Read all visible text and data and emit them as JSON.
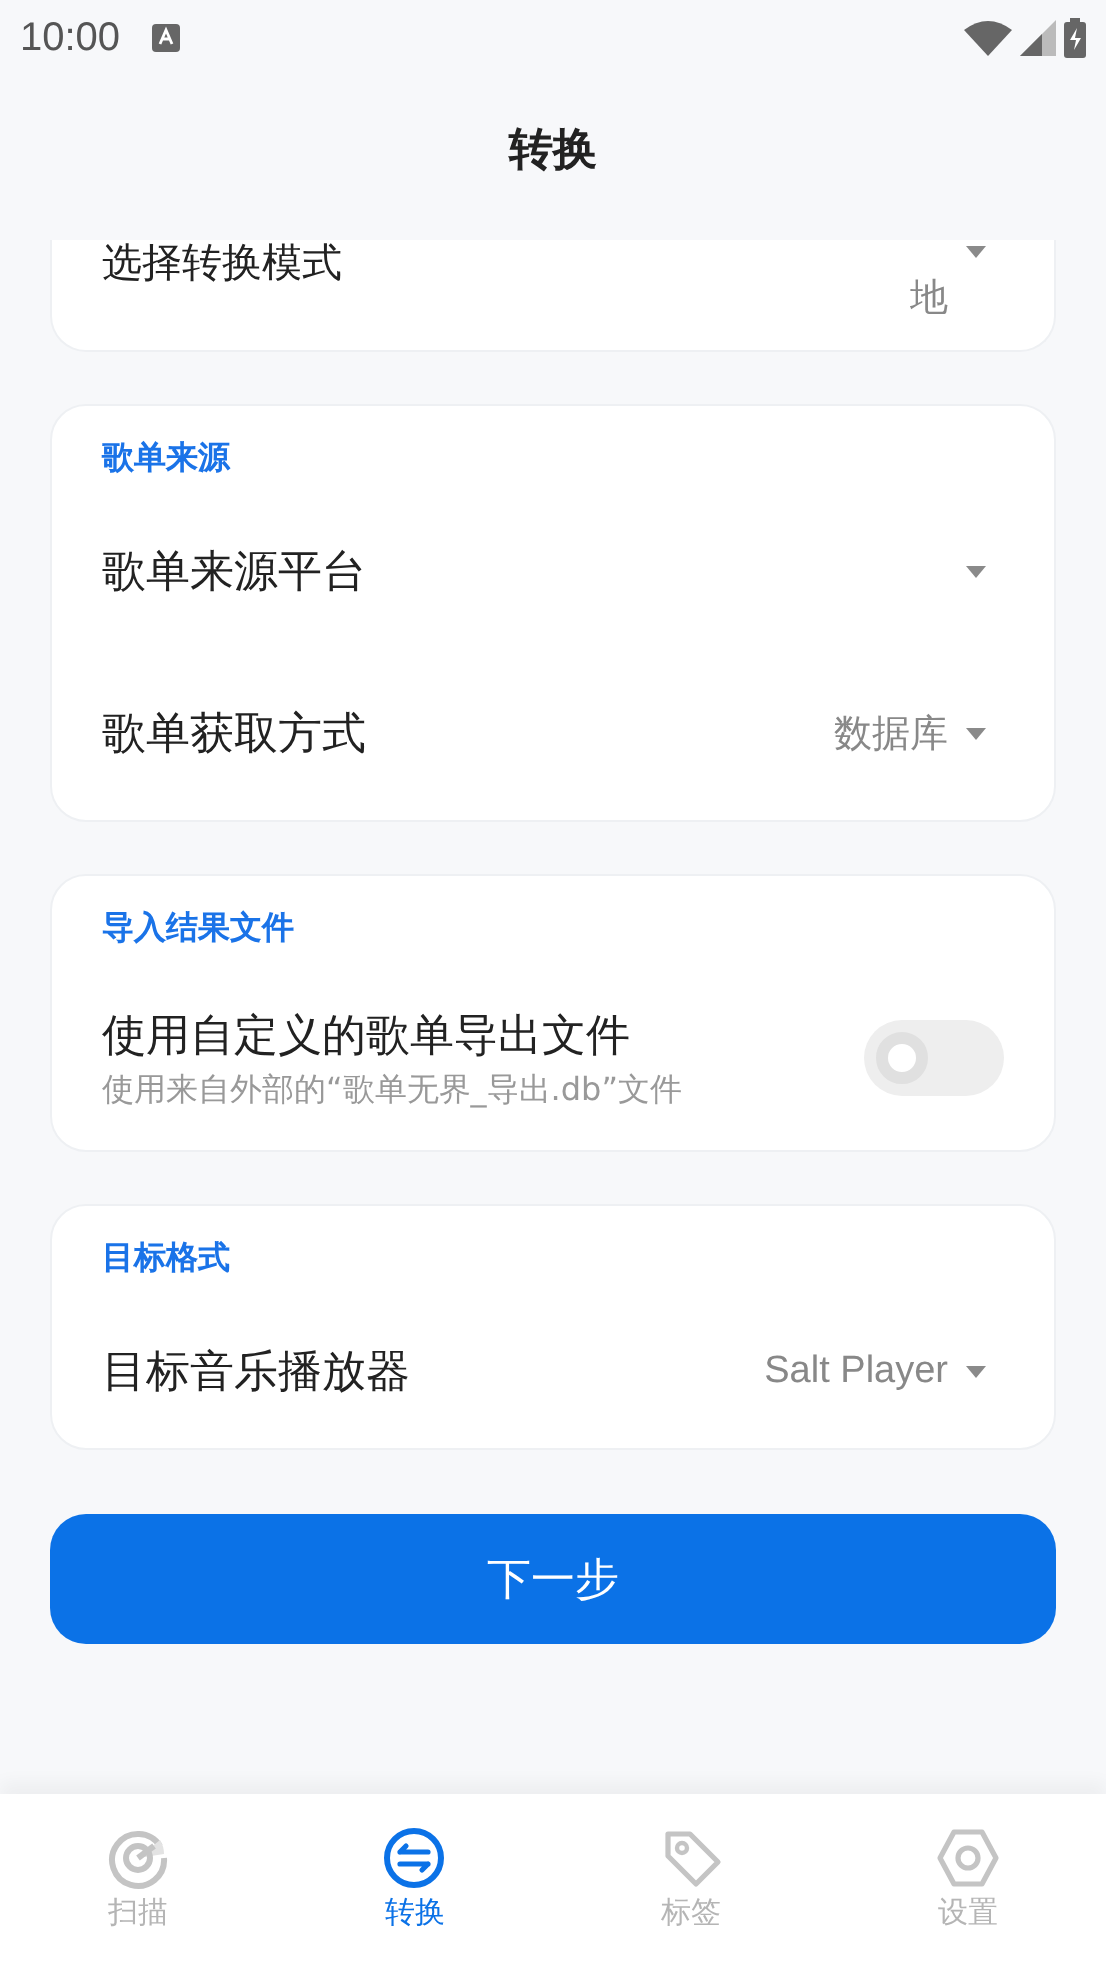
{
  "status_bar": {
    "time": "10:00"
  },
  "header": {
    "title": "转换"
  },
  "mode_card": {
    "label": "选择转换模式",
    "value": "地"
  },
  "sections": [
    {
      "title": "歌单来源",
      "rows": [
        {
          "kind": "dropdown",
          "label": "歌单来源平台"
        },
        {
          "kind": "dropdown",
          "label": "歌单获取方式",
          "value": "数据库"
        }
      ]
    },
    {
      "title": "导入结果文件",
      "rows": [
        {
          "kind": "toggle",
          "label": "使用自定义的歌单导出文件",
          "sublabel": "使用来自外部的“歌单无界_导出.db”文件",
          "on": false
        }
      ]
    },
    {
      "title": "目标格式",
      "rows": [
        {
          "kind": "dropdown",
          "label": "目标音乐播放器",
          "value": "Salt Player"
        }
      ]
    }
  ],
  "next_button": "下一步",
  "nav": [
    {
      "kind": "scan",
      "label": "扫描",
      "selected": false
    },
    {
      "kind": "convert",
      "label": "转换",
      "selected": true
    },
    {
      "kind": "tag",
      "label": "标签",
      "selected": false
    },
    {
      "kind": "settings",
      "label": "设置",
      "selected": false
    }
  ]
}
